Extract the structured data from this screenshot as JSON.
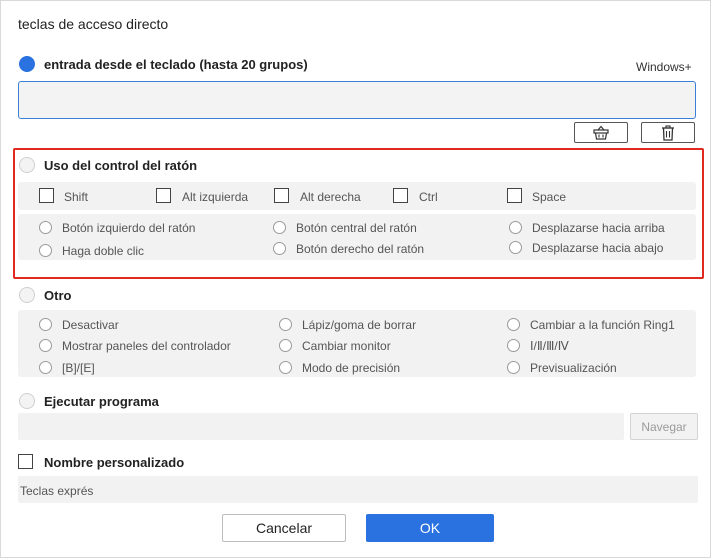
{
  "dialog": {
    "title": "teclas de acceso directo"
  },
  "keyboard": {
    "label": "entrada desde el teclado (hasta 20 grupos)",
    "selected": true,
    "suffix": "Windows+",
    "value": "",
    "clear_icon": "basket-icon",
    "delete_icon": "trash-icon"
  },
  "mouse": {
    "label": "Uso del control del ratón",
    "selected": false,
    "modifiers": [
      "Shift",
      "Alt izquierda",
      "Alt derecha",
      "Ctrl",
      "Space"
    ],
    "buttons": [
      "Botón izquierdo del ratón",
      "Botón central del ratón",
      "Desplazarse hacia arriba",
      "Haga doble clic",
      "Botón derecho del ratón",
      "Desplazarse hacia abajo"
    ]
  },
  "other": {
    "label": "Otro",
    "selected": false,
    "options": [
      "Desactivar",
      "Lápiz/goma de borrar",
      "Cambiar a la función Ring1",
      "Mostrar paneles del controlador",
      "Cambiar monitor",
      "Ⅰ/Ⅱ/Ⅲ/Ⅳ",
      "[B]/[E]",
      "Modo de precisión",
      "Previsualización"
    ]
  },
  "program": {
    "label": "Ejecutar programa",
    "selected": false,
    "value": "",
    "browse_label": "Navegar"
  },
  "custom_name": {
    "label": "Nombre personalizado",
    "checked": false,
    "value": "Teclas exprés"
  },
  "footer": {
    "cancel_label": "Cancelar",
    "ok_label": "OK"
  },
  "colors": {
    "accent": "#2a72e0",
    "highlight_frame": "#e0291f"
  }
}
